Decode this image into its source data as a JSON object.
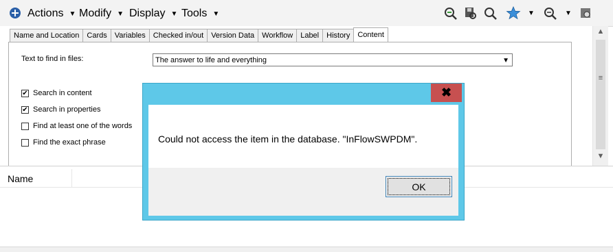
{
  "toolbar": {
    "menus": [
      {
        "label": "Actions"
      },
      {
        "label": "Modify"
      },
      {
        "label": "Display"
      },
      {
        "label": "Tools"
      }
    ],
    "icons": [
      "search-tree-icon",
      "save-search-icon",
      "search-refresh-icon",
      "favorites-star-icon",
      "zoom-icon",
      "settings-icon"
    ]
  },
  "tabs": [
    {
      "label": "Name and Location"
    },
    {
      "label": "Cards"
    },
    {
      "label": "Variables"
    },
    {
      "label": "Checked in/out"
    },
    {
      "label": "Version Data"
    },
    {
      "label": "Workflow"
    },
    {
      "label": "Label"
    },
    {
      "label": "History"
    },
    {
      "label": "Content",
      "active": true
    }
  ],
  "content_panel": {
    "text_label": "Text to find in files:",
    "text_value": "The answer to life and everything",
    "options": [
      {
        "label": "Search in content",
        "checked": true
      },
      {
        "label": "Search in properties",
        "checked": true
      },
      {
        "label": "Find at least one of the words",
        "checked": false
      },
      {
        "label": "Find the exact phrase",
        "checked": false
      }
    ]
  },
  "results": {
    "columns": [
      {
        "label": "Name"
      }
    ]
  },
  "dialog": {
    "close_glyph": "✖",
    "message": "Could not access the item in the database. \"InFlowSWPDM\".",
    "ok_label": "OK"
  },
  "colors": {
    "dialog_border": "#5ec8e8",
    "close_button": "#c75050",
    "ok_border": "#3c7fb1"
  }
}
